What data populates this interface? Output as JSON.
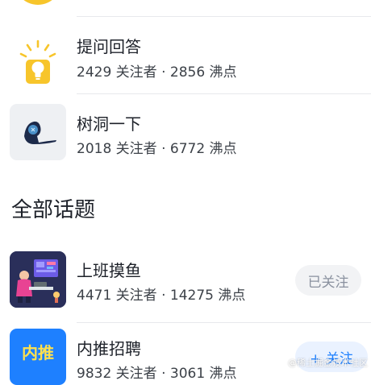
{
  "followed_topics": [
    {
      "title": "提问回答",
      "meta": "2429 关注者 · 2856 沸点",
      "icon": "lightbulb-icon"
    },
    {
      "title": "树洞一下",
      "meta": "2018 关注者 · 6772 沸点",
      "icon": "keyhole-icon"
    }
  ],
  "section": {
    "title": "全部话题"
  },
  "all_topics": [
    {
      "title": "上班摸鱼",
      "meta": "4471 关注者 · 14275 沸点",
      "button": "已关注",
      "icon": "office-illustration-icon"
    },
    {
      "title": "内推招聘",
      "meta": "9832 关注者 · 3061 沸点",
      "button": "+ 关注",
      "badge": "内推",
      "icon": "referral-badge-icon"
    }
  ],
  "watermark": "@稀土掘金技术社区",
  "colors": {
    "accent": "#1e80ff",
    "yellow": "#f7c52b",
    "muted": "#8a919f",
    "navy": "#2a2f5a"
  }
}
